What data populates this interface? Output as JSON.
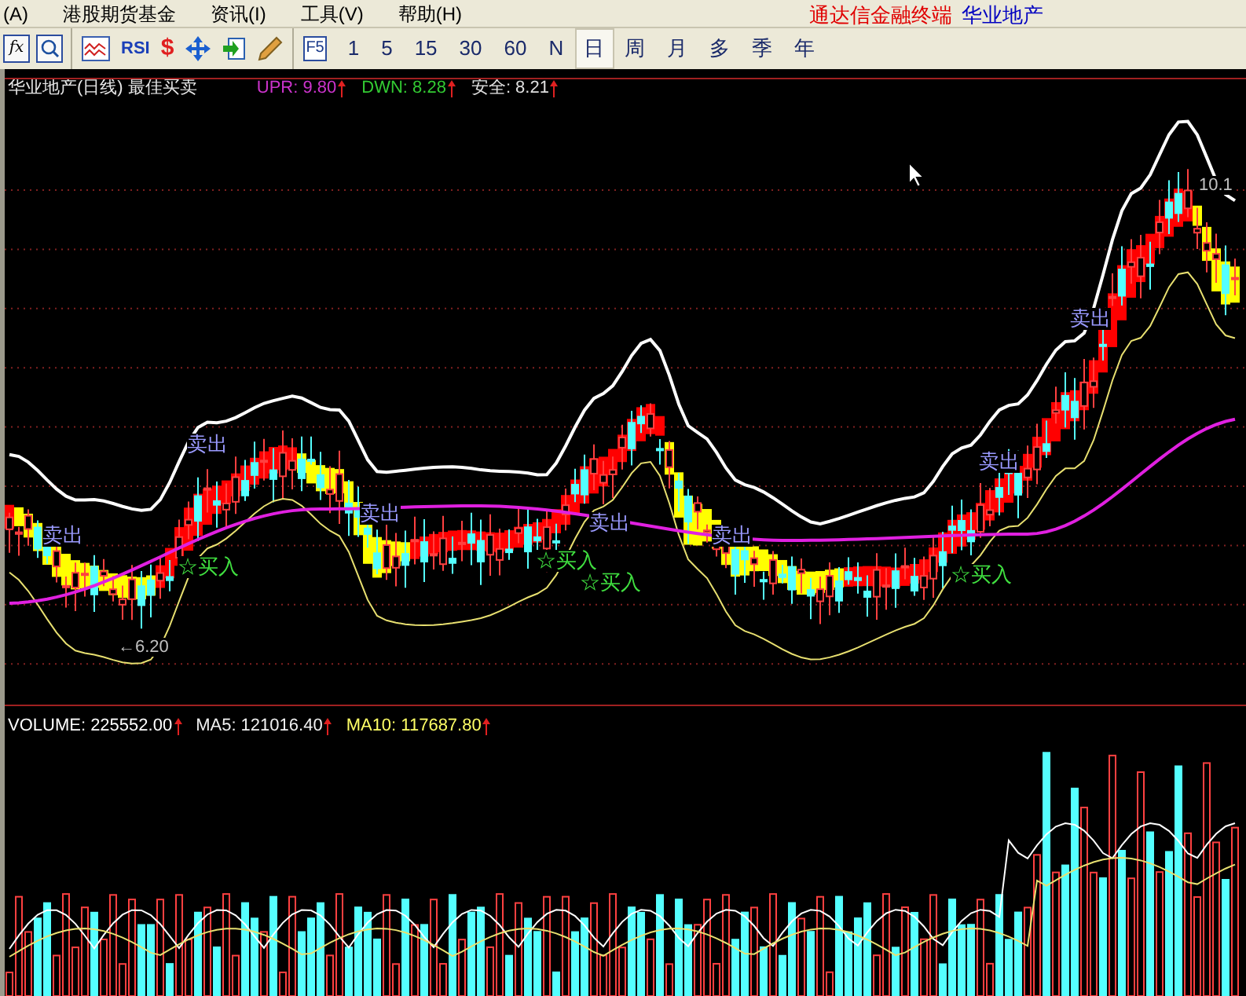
{
  "menu": [
    "(A)",
    "港股期货基金",
    "资讯(I)",
    "工具(V)",
    "帮助(H)"
  ],
  "app_title": "通达信金融终端",
  "stock_name": "华业地产",
  "toolbar": {
    "formula_label": "fx",
    "text_tools": [
      {
        "kind": "rsi",
        "label": "RSI"
      },
      {
        "kind": "dollar",
        "label": "$"
      }
    ],
    "function_key": "F5",
    "periods": [
      {
        "label": "1",
        "selected": false
      },
      {
        "label": "5",
        "selected": false
      },
      {
        "label": "15",
        "selected": false
      },
      {
        "label": "30",
        "selected": false
      },
      {
        "label": "60",
        "selected": false
      },
      {
        "label": "N",
        "selected": false
      },
      {
        "label": "日",
        "selected": true
      },
      {
        "label": "周",
        "selected": false
      },
      {
        "label": "月",
        "selected": false
      },
      {
        "label": "多",
        "selected": false
      },
      {
        "label": "季",
        "selected": false
      },
      {
        "label": "年",
        "selected": false
      }
    ]
  },
  "main_panel": {
    "title": "华业地产(日线) 最佳买卖",
    "indicators": [
      {
        "label": "UPR: 9.80",
        "color": "#cc33cc"
      },
      {
        "label": "DWN: 8.28",
        "color": "#33cc33"
      },
      {
        "label": "安全: 8.21",
        "color": "#e0e0e0"
      }
    ],
    "signals": [
      {
        "kind": "sell",
        "text": "卖出"
      },
      {
        "kind": "sell",
        "text": "卖出"
      },
      {
        "kind": "buy",
        "text": "☆买入"
      },
      {
        "kind": "sell",
        "text": "卖出"
      },
      {
        "kind": "buy",
        "text": "☆买入"
      },
      {
        "kind": "buy",
        "text": "☆买入"
      },
      {
        "kind": "sell",
        "text": "卖出"
      },
      {
        "kind": "sell",
        "text": "卖出"
      },
      {
        "kind": "sell",
        "text": "卖出"
      },
      {
        "kind": "sell",
        "text": "卖出"
      },
      {
        "kind": "buy",
        "text": "☆买入"
      }
    ],
    "price_labels": [
      "←6.20",
      "10.1"
    ]
  },
  "volume_panel": {
    "indicators": [
      {
        "label": "VOLUME: 225552.00",
        "color": "#ffffff"
      },
      {
        "label": "MA5: 121016.40",
        "color": "#f0f0f0"
      },
      {
        "label": "MA10: 117687.80",
        "color": "#ffff66"
      }
    ]
  }
}
